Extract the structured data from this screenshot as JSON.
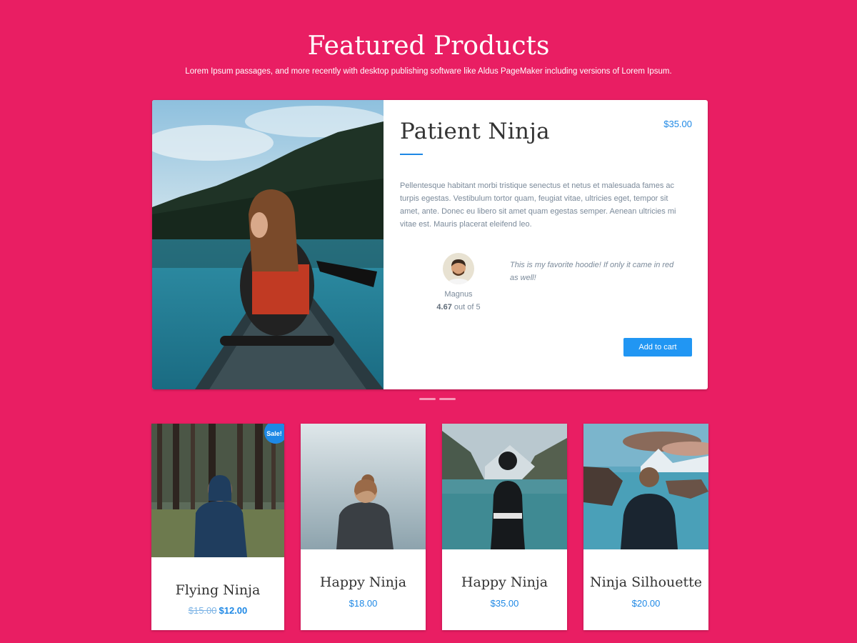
{
  "header": {
    "title": "Featured Products",
    "subtitle": "Lorem Ipsum passages, and more recently with desktop publishing software like Aldus PageMaker including versions of Lorem Ipsum."
  },
  "featured": {
    "name": "Patient Ninja",
    "price": "$35.00",
    "description": "Pellentesque habitant morbi tristique senectus et netus et malesuada fames ac turpis egestas. Vestibulum tortor quam, feugiat vitae, ultricies eget, tempor sit amet, ante. Donec eu libero sit amet quam egestas semper. Aenean ultricies mi vitae est. Mauris placerat eleifend leo.",
    "review": {
      "author": "Magnus",
      "rating_value": "4.67",
      "rating_suffix": "out of 5",
      "quote": "This is my favorite hoodie! If only it came in red as well!"
    },
    "add_to_cart_label": "Add to cart"
  },
  "carousel": {
    "slides": 2
  },
  "products": [
    {
      "name": "Flying Ninja",
      "old_price": "$15.00",
      "price": "$12.00",
      "badge": "Sale!"
    },
    {
      "name": "Happy Ninja",
      "price": "$18.00"
    },
    {
      "name": "Happy Ninja",
      "price": "$35.00"
    },
    {
      "name": "Ninja Silhouette",
      "price": "$20.00"
    }
  ],
  "colors": {
    "background": "#e91e63",
    "accent": "#1e88e5",
    "button": "#2196f3"
  }
}
